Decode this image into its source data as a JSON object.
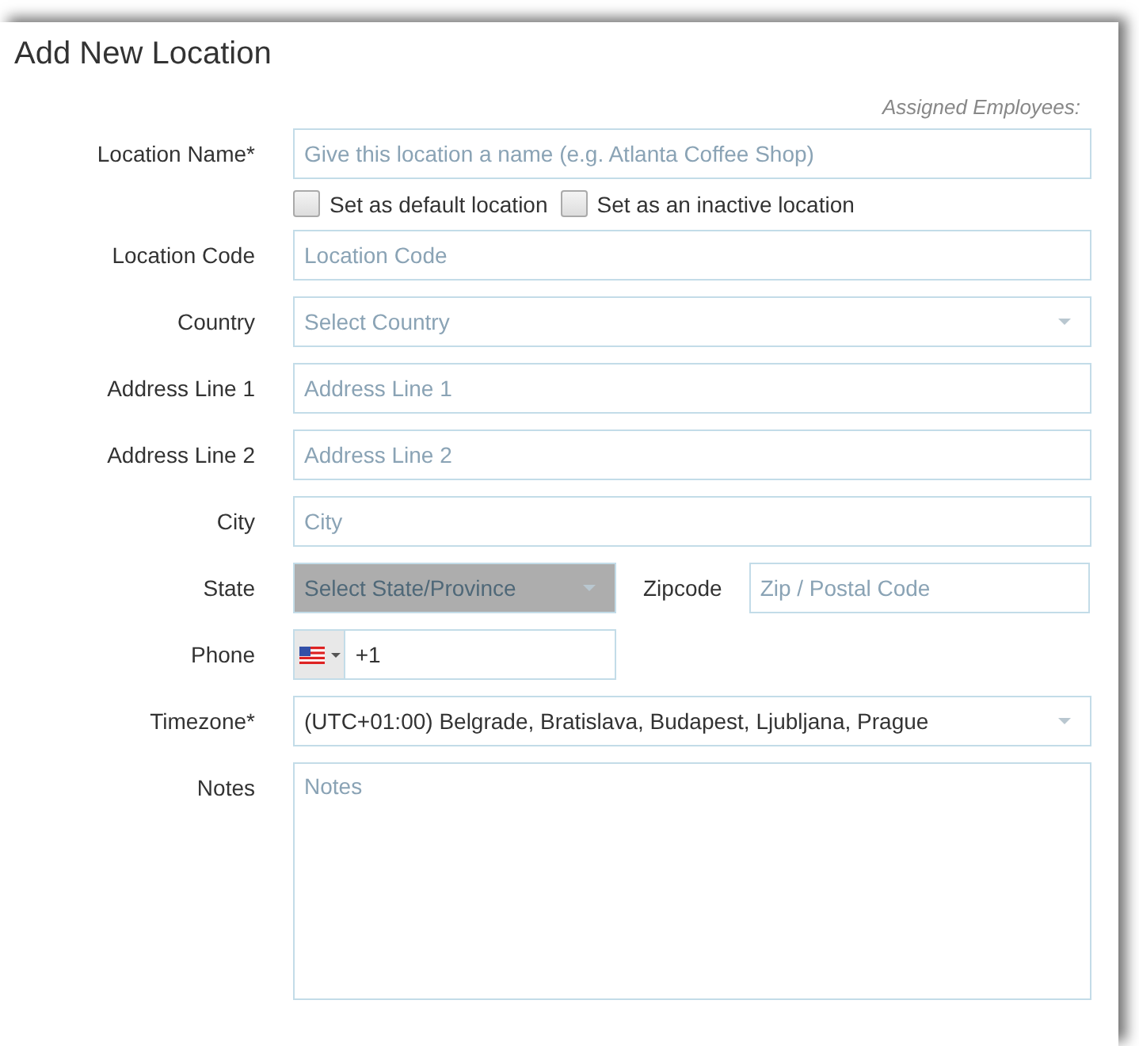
{
  "title": "Add New Location",
  "assigned_label": "Assigned Employees:",
  "rows": [
    {
      "kind": "text",
      "label": "Location Name*",
      "placeholder": "Give this location a name (e.g. Atlanta Coffee Shop)",
      "checkboxes": [
        {
          "label": "Set as default location",
          "checked": false
        },
        {
          "label": "Set as an inactive location",
          "checked": false
        }
      ]
    },
    {
      "kind": "text",
      "label": "Location Code",
      "placeholder": "Location Code"
    },
    {
      "kind": "select",
      "label": "Country",
      "placeholder": "Select Country"
    },
    {
      "kind": "text",
      "label": "Address Line 1",
      "placeholder": "Address Line 1"
    },
    {
      "kind": "text",
      "label": "Address Line 2",
      "placeholder": "Address Line 2"
    },
    {
      "kind": "text",
      "label": "City",
      "placeholder": "City"
    },
    {
      "kind": "split",
      "label": "State",
      "select": {
        "placeholder": "Select State/Province",
        "disabled": true
      },
      "second_label": "Zipcode",
      "second": {
        "placeholder": "Zip / Postal Code"
      }
    },
    {
      "kind": "phone",
      "label": "Phone",
      "value": "+1"
    },
    {
      "kind": "select",
      "label": "Timezone*",
      "value": "(UTC+01:00) Belgrade, Bratislava, Budapest, Ljubljana, Prague"
    },
    {
      "kind": "textarea",
      "label": "Notes",
      "placeholder": "Notes"
    }
  ]
}
